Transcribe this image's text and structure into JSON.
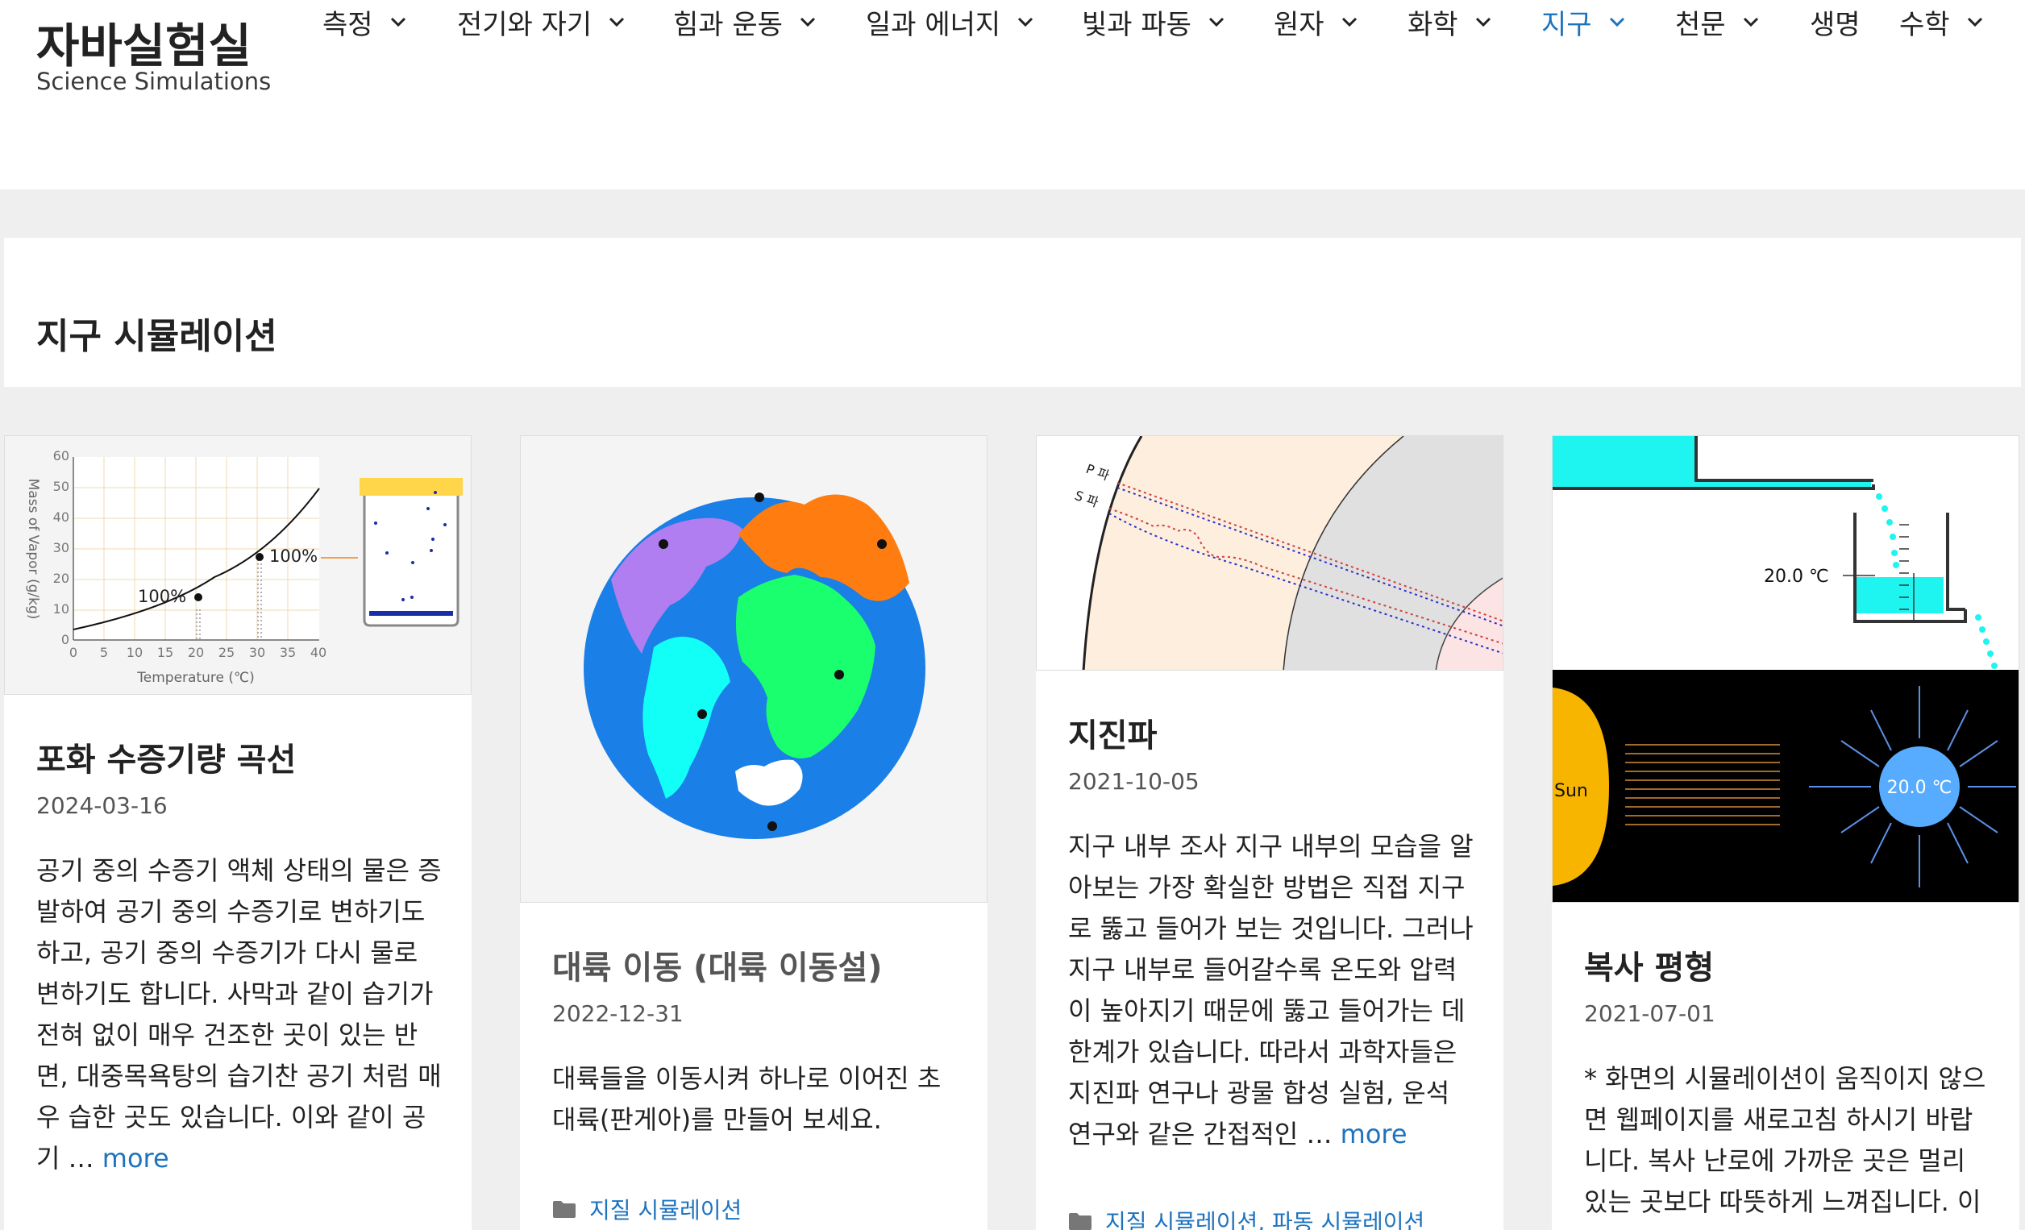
{
  "site": {
    "title": "자바실험실",
    "description": "Science Simulations"
  },
  "nav": {
    "items": [
      {
        "label": "측정"
      },
      {
        "label": "전기와 자기"
      },
      {
        "label": "힘과 운동"
      },
      {
        "label": "일과 에너지"
      },
      {
        "label": "빛과 파동"
      },
      {
        "label": "원자"
      },
      {
        "label": "화학"
      },
      {
        "label": "지구"
      },
      {
        "label": "천문"
      },
      {
        "label": "생명"
      },
      {
        "label": "수학"
      }
    ],
    "active_color": "#1e73be"
  },
  "page": {
    "title": "지구 시뮬레이션"
  },
  "cards": [
    {
      "title": "포화 수증기량 곡선",
      "date": "2024-03-16",
      "excerpt": "공기 중의 수증기 액체 상태의 물은 증발하여 공기 중의 수증기로 변하기도 하고, 공기 중의 수증기가 다시 물로 변하기도 합니다. 사막과 같이 습기가 전혀 없이 매우 건조한 곳이 있는 반면, 대중목욕탕의 습기찬 공기 처럼 매우 습한 곳도 있습니다. 이와 같이 공기 …",
      "more": "more",
      "thumb": {
        "y_axis_label": "Mass of Vapor (g/kg)",
        "x_axis_label": "Temperature (℃)",
        "y_ticks": [
          "0",
          "10",
          "20",
          "30",
          "40",
          "50",
          "60"
        ],
        "x_ticks": [
          "0",
          "5",
          "10",
          "15",
          "20",
          "25",
          "30",
          "35",
          "40"
        ],
        "marker_left": "100%",
        "marker_right": "100%"
      }
    },
    {
      "title": "대륙 이동 (대륙 이동설)",
      "date": "2022-12-31",
      "excerpt": "대륙들을 이동시켜 하나로 이어진 초대륙(판게아)를 만들어 보세요.",
      "category": "지질 시뮬레이션"
    },
    {
      "title": "지진파",
      "date": "2021-10-05",
      "excerpt": "지구 내부 조사 지구 내부의 모습을 알아보는 가장 확실한 방법은 직접 지구로 뚫고 들어가 보는 것입니다. 그러나 지구 내부로 들어갈수록 온도와 압력이 높아지기 때문에 뚫고 들어가는 데 한계가 있습니다. 따라서 과학자들은 지진파 연구나 광물 합성 실험, 운석 연구와 같은 간접적인 …",
      "more": "more",
      "category": "지질 시뮬레이션, 파동 시뮬레이션",
      "thumb": {
        "p_label": "P 파",
        "s_label": "S 파"
      }
    },
    {
      "title": "복사 평형",
      "date": "2021-07-01",
      "excerpt": "* 화면의 시뮬레이션이 움직이지 않으면 웹페이지를 새로고침 하시기 바랍니다. 복사 난로에 가까운 곳은 멀리 있는 곳보다 따뜻하게 느껴집니다. 이",
      "thumb": {
        "temp_top": "20.0 ℃",
        "sun_label": "Sun",
        "temp_bottom": "20.0 ℃"
      }
    }
  ]
}
